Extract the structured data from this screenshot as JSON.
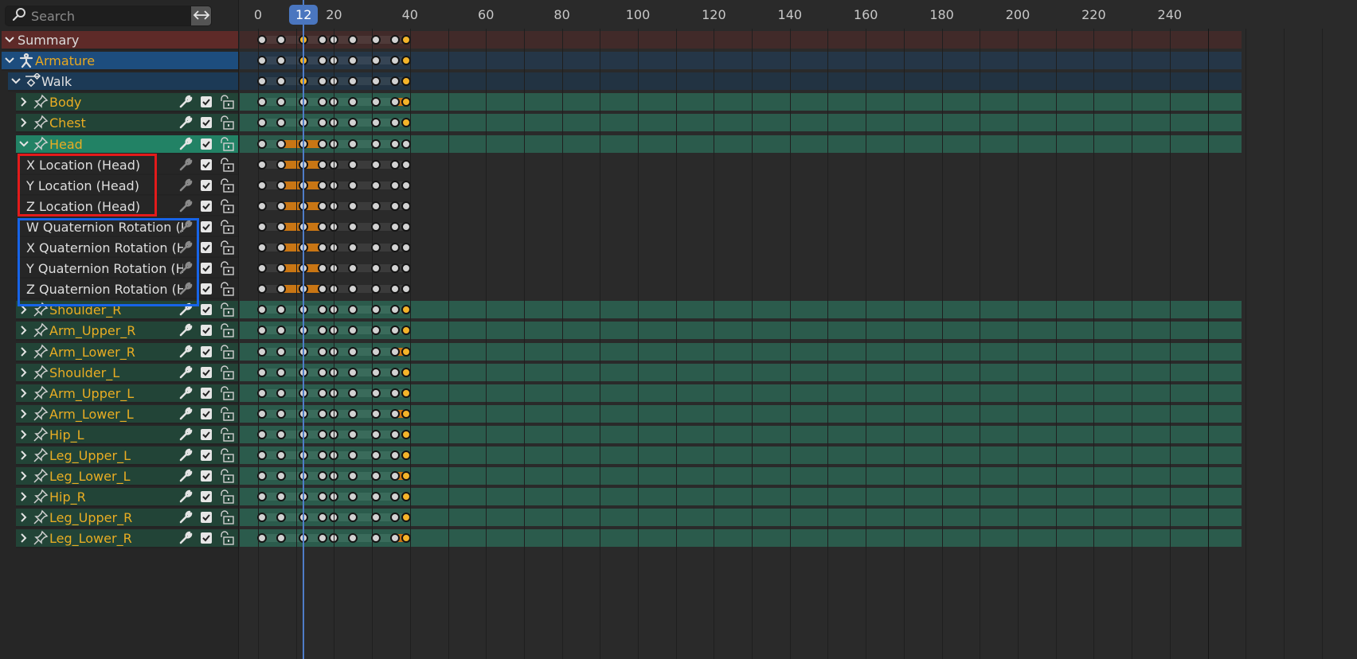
{
  "search": {
    "placeholder": "Search",
    "value": ""
  },
  "summary": {
    "label": "Summary"
  },
  "object": {
    "label": "Armature"
  },
  "action": {
    "label": "Walk"
  },
  "groups": [
    {
      "label": "Body",
      "expanded": false
    },
    {
      "label": "Chest",
      "expanded": false
    },
    {
      "label": "Head",
      "expanded": true,
      "active": true,
      "channels": [
        {
          "label": "X Location (Head)"
        },
        {
          "label": "Y Location (Head)"
        },
        {
          "label": "Z Location (Head)"
        },
        {
          "label": "W Quaternion Rotation (Head)"
        },
        {
          "label": "X Quaternion Rotation (Head)"
        },
        {
          "label": "Y Quaternion Rotation (Head)"
        },
        {
          "label": "Z Quaternion Rotation (Head)"
        }
      ]
    },
    {
      "label": "Shoulder_R",
      "expanded": false
    },
    {
      "label": "Arm_Upper_R",
      "expanded": false
    },
    {
      "label": "Arm_Lower_R",
      "expanded": false
    },
    {
      "label": "Shoulder_L",
      "expanded": false
    },
    {
      "label": "Arm_Upper_L",
      "expanded": false
    },
    {
      "label": "Arm_Lower_L",
      "expanded": false
    },
    {
      "label": "Hip_L",
      "expanded": false
    },
    {
      "label": "Leg_Upper_L",
      "expanded": false
    },
    {
      "label": "Leg_Lower_L",
      "expanded": false
    },
    {
      "label": "Hip_R",
      "expanded": false
    },
    {
      "label": "Leg_Upper_R",
      "expanded": false
    },
    {
      "label": "Leg_Lower_R",
      "expanded": false
    }
  ],
  "timeline": {
    "ruler": [
      "0",
      "20",
      "40",
      "60",
      "80",
      "100",
      "120",
      "140",
      "160",
      "180",
      "200",
      "220",
      "240"
    ],
    "current_frame": "12",
    "scene_end_frame": 250,
    "keyframe_frames": [
      1,
      6,
      12,
      17,
      20,
      25,
      31,
      36,
      39
    ]
  },
  "colors": {
    "summary": "#5e2a28",
    "object": "#1d4d7e",
    "action": "#1c3a56",
    "group": "#224437",
    "group_active": "#228265",
    "group_text": "#e9ad23",
    "key_normal": "#d2d2d2",
    "key_selected": "#f4b42a",
    "hold_moving": "#c97614",
    "playhead": "#4a76bf",
    "highlight_red": "#e31b1b",
    "highlight_blue": "#1764e8"
  },
  "highlights": [
    {
      "name": "location-channels",
      "color": "red"
    },
    {
      "name": "rotation-channels",
      "color": "blue"
    }
  ],
  "icons": [
    "search-icon",
    "swap-icon",
    "chevron-down-icon",
    "chevron-right-icon",
    "armature-icon",
    "action-icon",
    "pin-icon",
    "wrench-icon",
    "checkbox-icon",
    "lock-icon"
  ]
}
